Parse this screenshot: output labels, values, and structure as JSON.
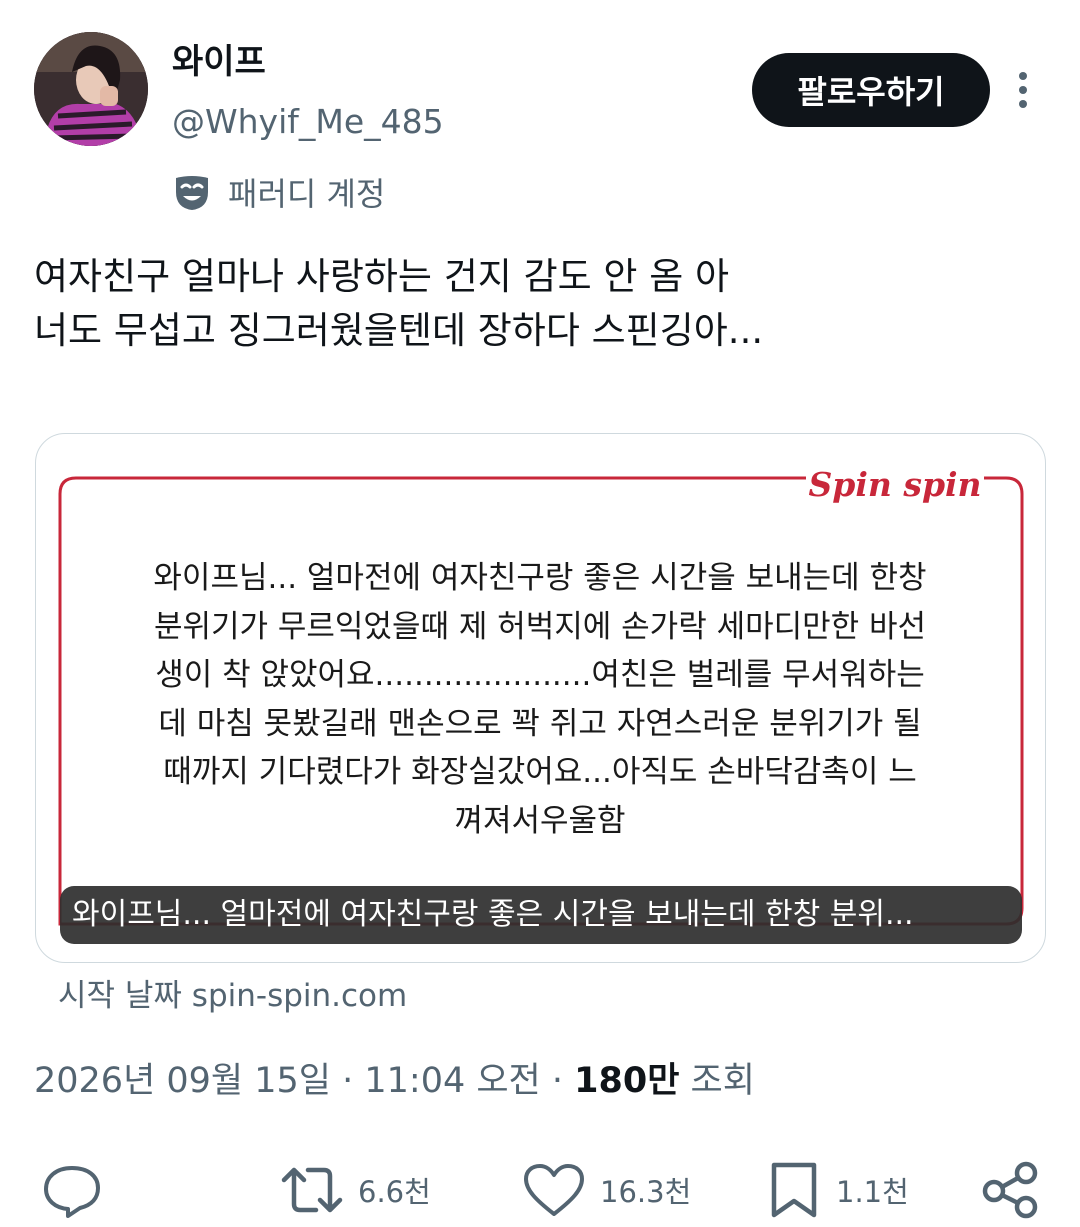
{
  "author": {
    "display_name": "와이프",
    "handle": "@Whyif_Me_485",
    "parody_label": "패러디 계정",
    "follow_label": "팔로우하기"
  },
  "tweet": {
    "lines": [
      "여자친구 얼마나 사랑하는 건지 감도 안 옴 아",
      "너도 무섭고 징그러웠을텐데 장하다 스핀깅아..."
    ]
  },
  "card": {
    "brand": "Spin spin",
    "story": "와이프님... 얼마전에 여자친구랑 좋은 시간을 보내는데 한창\n분위기가 무르익었을때 제 허벅지에 손가락 세마디만한 바선\n생이 착 앉았어요......................여친은 벌레를 무서워하는\n데 마침 못봤길래 맨손으로 꽉 쥐고 자연스러운 분위기가 될\n때까지 기다렸다가 화장실갔어요...아직도 손바닥감촉이 느\n껴져서우울함",
    "caption": "와이프님... 얼마전에 여자친구랑 좋은 시간을 보내는데 한창 분위...",
    "source": "시작 날짜 spin-spin.com"
  },
  "meta": {
    "date": "2026년 09월 15일 · 11:04 오전 · ",
    "views": "180만",
    "views_label": " 조회"
  },
  "actions": {
    "retweets": "6.6천",
    "likes": "16.3천",
    "bookmarks": "1.1천"
  },
  "colors": {
    "brand_red": "#c8273a",
    "muted": "#536471",
    "follow_bg": "#0f1419"
  },
  "icons": [
    "more-vertical-icon",
    "parody-mask-icon",
    "reply-icon",
    "retweet-icon",
    "like-icon",
    "bookmark-icon",
    "share-icon"
  ]
}
